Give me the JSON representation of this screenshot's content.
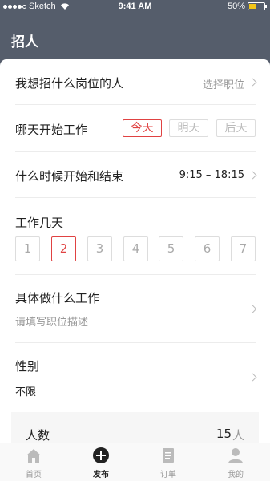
{
  "status_bar": {
    "carrier": "Sketch",
    "time": "9:41 AM",
    "battery": "50%",
    "battery_level": 0.5,
    "signal_bars": 4
  },
  "nav": {
    "title": "招人"
  },
  "form": {
    "position": {
      "label": "我想招什么岗位的人",
      "hint": "选择职位"
    },
    "start_day": {
      "label": "哪天开始工作",
      "options": [
        "今天",
        "明天",
        "后天"
      ],
      "selected": "今天"
    },
    "time_range": {
      "label": "什么时候开始和结束",
      "value": "9:15 – 18:15"
    },
    "days": {
      "label": "工作几天",
      "options": [
        "1",
        "2",
        "3",
        "4",
        "5",
        "6",
        "7"
      ],
      "selected": "2"
    },
    "description": {
      "label": "具体做什么工作",
      "placeholder": "请填写职位描述"
    },
    "gender": {
      "label": "性别",
      "value": "不限"
    },
    "people": {
      "label": "人数",
      "value": "15",
      "unit": "人"
    }
  },
  "tabbar": {
    "items": [
      {
        "label": "首页",
        "icon": "home-icon"
      },
      {
        "label": "发布",
        "icon": "plus-circle-icon"
      },
      {
        "label": "订单",
        "icon": "document-icon"
      },
      {
        "label": "我的",
        "icon": "person-icon"
      }
    ],
    "active": "发布"
  },
  "colors": {
    "header_bg": "#555d6b",
    "accent_red": "#e04242",
    "battery_yellow": "#f2c518"
  }
}
